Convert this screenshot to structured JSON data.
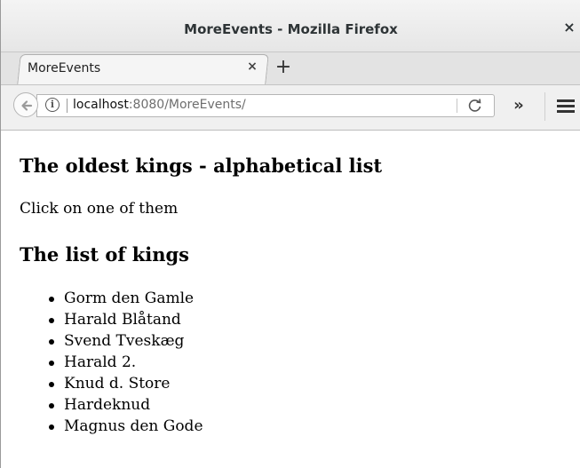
{
  "window": {
    "title": "MoreEvents - Mozilla Firefox",
    "close_glyph": "×"
  },
  "tabs": [
    {
      "label": "MoreEvents",
      "close_glyph": "×"
    }
  ],
  "new_tab_glyph": "+",
  "urlbar": {
    "host": "localhost",
    "rest": ":8080/MoreEvents/"
  },
  "overflow_glyph": "»",
  "page": {
    "heading": "The oldest kings - alphabetical list",
    "intro": "Click on one of them",
    "list_heading": "The list of kings",
    "kings": [
      "Gorm den Gamle",
      "Harald Blåtand",
      "Svend Tveskæg",
      "Harald 2.",
      "Knud d. Store",
      "Hardeknud",
      "Magnus den Gode"
    ]
  }
}
